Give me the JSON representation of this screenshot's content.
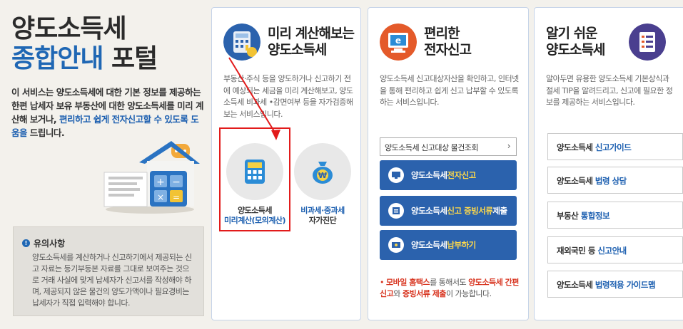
{
  "portal": {
    "title_line1": "양도소득세",
    "title_line2_blue": "종합안내",
    "title_line2_rest": " 포털",
    "intro_part1": "이 서비스는 양도소득세에 대한 기본 정보를 제공하는 한편 납세자 보유 부동산에 대한 양도소득세를 미리 계산해 보거나, ",
    "intro_highlight": "편리하고 쉽게 전자신고할 수 있도록 도움을",
    "intro_part2": " 드립니다."
  },
  "notice": {
    "title": "유의사항",
    "body": "양도소득세를 계산하거나 신고하기에서 제공되는 신고 자료는 등기부등본 자료를 그대로 보여주는 것으로 거래 사실에 맞게 납세자가 신고서를 작성해야 하며, 제공되지 않은 물건의 양도가액이나 필요경비는 납세자가 직접 입력해야 합니다."
  },
  "panel_calc": {
    "title_line1": "미리 계산해보는",
    "title_line2": "양도소득세",
    "desc": "부동산·주식 등을 양도하거나 신고하기 전에 예상되는 세금을 미리 계산해보고, 양도소득세 비과세 •감면여부 등을 자가검증해보는 서비스입니다.",
    "svc1_line1": "양도소득세",
    "svc1_line2": "미리계산(모의계산)",
    "svc2_line1": "비과세·중과세",
    "svc2_line2": "자가진단"
  },
  "panel_efile": {
    "title_line1": "편리한",
    "title_line2": "전자신고",
    "desc": "양도소득세 신고대상자산을 확인하고, 인터넷을 통해 편리하고 쉽게 신고 납부할 수 있도록 하는 서비스입니다.",
    "search_label": "양도소득세 신고대상 물건조회",
    "btn1_pre": "양도소득세 ",
    "btn1_hl": "전자신고",
    "btn2_pre": "양도소득세 ",
    "btn2_hl": "신고 증빙서류",
    "btn2_post": " 제출",
    "btn3_pre": "양도소득세 ",
    "btn3_hl": "납부하기",
    "mobile_a": "모바일 홈택스",
    "mobile_b": "를 통해서도 ",
    "mobile_c": "양도소득세 간편신고",
    "mobile_d": "와 ",
    "mobile_e": "증빙서류 제출",
    "mobile_f": "이 가능합니다."
  },
  "panel_info": {
    "title_line1": "알기 쉬운",
    "title_line2": "양도소득세",
    "desc": "알아두면 유용한 양도소득세 기본상식과 절세 TIP을 알려드리고, 신고에 필요한 정보를 제공하는 서비스입니다.",
    "link1_pre": "양도소득세 ",
    "link1_hl": "신고가이드",
    "link2_pre": "양도소득세 ",
    "link2_hl": "법령 상담",
    "link3_pre": "부동산 ",
    "link3_hl": "통합정보",
    "link4_pre": "재외국민 등 ",
    "link4_hl": "신고안내",
    "link5_pre": "양도소득세 ",
    "link5_hl": "법령적용 가이드맵"
  },
  "colors": {
    "accent_blue": "#1f67b4",
    "button_blue": "#2b62ad",
    "highlight_yellow": "#ffd94a",
    "annotation_red": "#e21b1b"
  }
}
